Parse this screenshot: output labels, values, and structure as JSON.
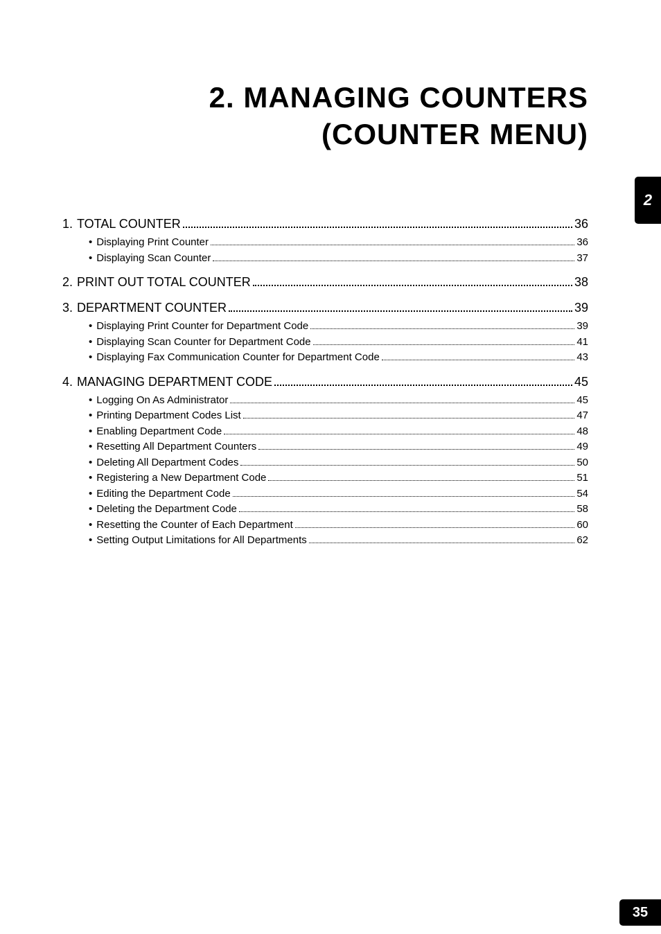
{
  "title_line1": "2. MANAGING COUNTERS",
  "title_line2": "(COUNTER MENU)",
  "tab_number": "2",
  "page_number": "35",
  "toc": [
    {
      "num": "1.",
      "label": "TOTAL COUNTER",
      "page": "36",
      "subs": [
        {
          "label": "Displaying Print Counter",
          "page": "36"
        },
        {
          "label": "Displaying Scan Counter",
          "page": "37"
        }
      ]
    },
    {
      "num": "2.",
      "label": "PRINT OUT TOTAL COUNTER",
      "page": "38",
      "subs": []
    },
    {
      "num": "3.",
      "label": "DEPARTMENT COUNTER",
      "page": "39",
      "subs": [
        {
          "label": "Displaying Print Counter for Department Code",
          "page": "39"
        },
        {
          "label": "Displaying Scan Counter for Department Code",
          "page": "41"
        },
        {
          "label": "Displaying Fax Communication Counter for Department Code",
          "page": "43"
        }
      ]
    },
    {
      "num": "4.",
      "label": "MANAGING DEPARTMENT CODE",
      "page": "45",
      "subs": [
        {
          "label": "Logging On As Administrator",
          "page": "45"
        },
        {
          "label": "Printing Department Codes List",
          "page": "47"
        },
        {
          "label": "Enabling Department Code",
          "page": "48"
        },
        {
          "label": "Resetting All Department Counters",
          "page": "49"
        },
        {
          "label": "Deleting All Department Codes",
          "page": "50"
        },
        {
          "label": "Registering a New Department Code",
          "page": "51"
        },
        {
          "label": "Editing the Department Code",
          "page": "54"
        },
        {
          "label": "Deleting the Department Code",
          "page": "58"
        },
        {
          "label": "Resetting the Counter of Each Department",
          "page": "60"
        },
        {
          "label": "Setting Output Limitations for All Departments",
          "page": "62"
        }
      ]
    }
  ]
}
